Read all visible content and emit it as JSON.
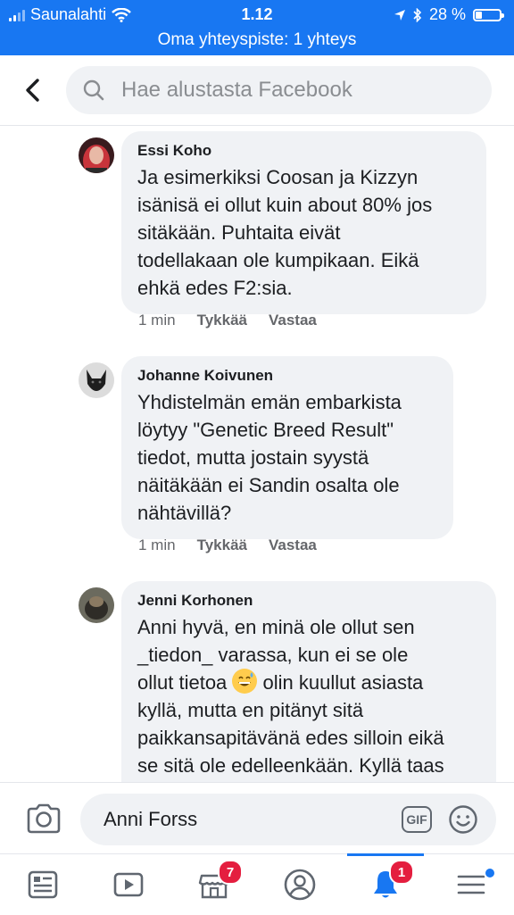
{
  "status_bar": {
    "carrier": "Saunalahti",
    "time": "1.12",
    "battery": "28 %",
    "battery_level": 0.28,
    "hotspot": "Oma yhteyspiste: 1 yhteys"
  },
  "search": {
    "placeholder": "Hae alustasta Facebook"
  },
  "comments": [
    {
      "author": "Essi Koho",
      "text": "Ja esimerkiksi Coosan ja Kizzyn\nisänisä ei ollut kuin about 80% jos\nsitäkään. Puhtaita eivät\ntodellakaan ole kumpikaan. Eikä\nehkä edes F2:sia.",
      "time": "1 min",
      "like": "Tykkää",
      "reply": "Vastaa"
    },
    {
      "author": "Johanne Koivunen",
      "text": "Yhdistelmän emän embarkista\nlöytyy \"Genetic Breed Result\"\ntiedot, mutta jostain syystä\nnäitäkään ei Sandin osalta ole\nnähtävillä?",
      "time": "1 min",
      "like": "Tykkää",
      "reply": "Vastaa"
    },
    {
      "author": "Jenni Korhonen",
      "text_before_emoji": "Anni hyvä, en minä ole ollut sen\n_tiedon_ varassa, kun ei se ole\nollut tietoa ",
      "text_after_emoji": " olin kuullut asiasta\nkyllä, mutta en pitänyt sitä\npaikkansapitävänä edes silloin eikä\nse sitä ole edelleenkään. Kyllä taas"
    }
  ],
  "composer": {
    "author": "Anni Forss",
    "gif_label": "GIF"
  },
  "tabbar": {
    "marketplace_badge": "7",
    "notifications_badge": "1"
  },
  "colors": {
    "brand": "#1877f2",
    "bubble": "#f0f2f5",
    "badge": "#e41e3f"
  }
}
